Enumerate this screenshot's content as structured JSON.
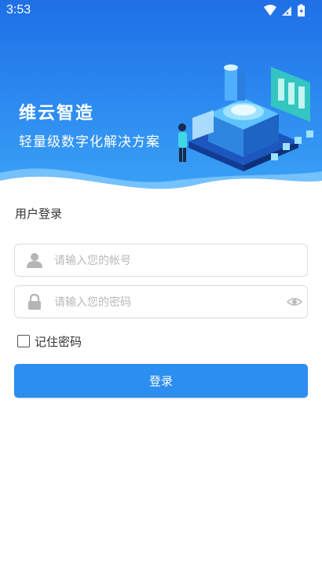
{
  "status_bar": {
    "time": "3:53",
    "icons": [
      "wifi-icon",
      "cell-signal-icon",
      "battery-icon"
    ]
  },
  "hero": {
    "title": "维云智造",
    "subtitle": "轻量级数字化解决方案"
  },
  "login": {
    "heading": "用户登录",
    "username_placeholder": "请输入您的帐号",
    "password_placeholder": "请输入您的密码",
    "remember_label": "记住密码",
    "remember_checked": false,
    "submit_label": "登录"
  },
  "colors": {
    "primary": "#2b8ef0",
    "hero_top": "#1f6fe6",
    "hero_bottom": "#3aa2f6"
  }
}
